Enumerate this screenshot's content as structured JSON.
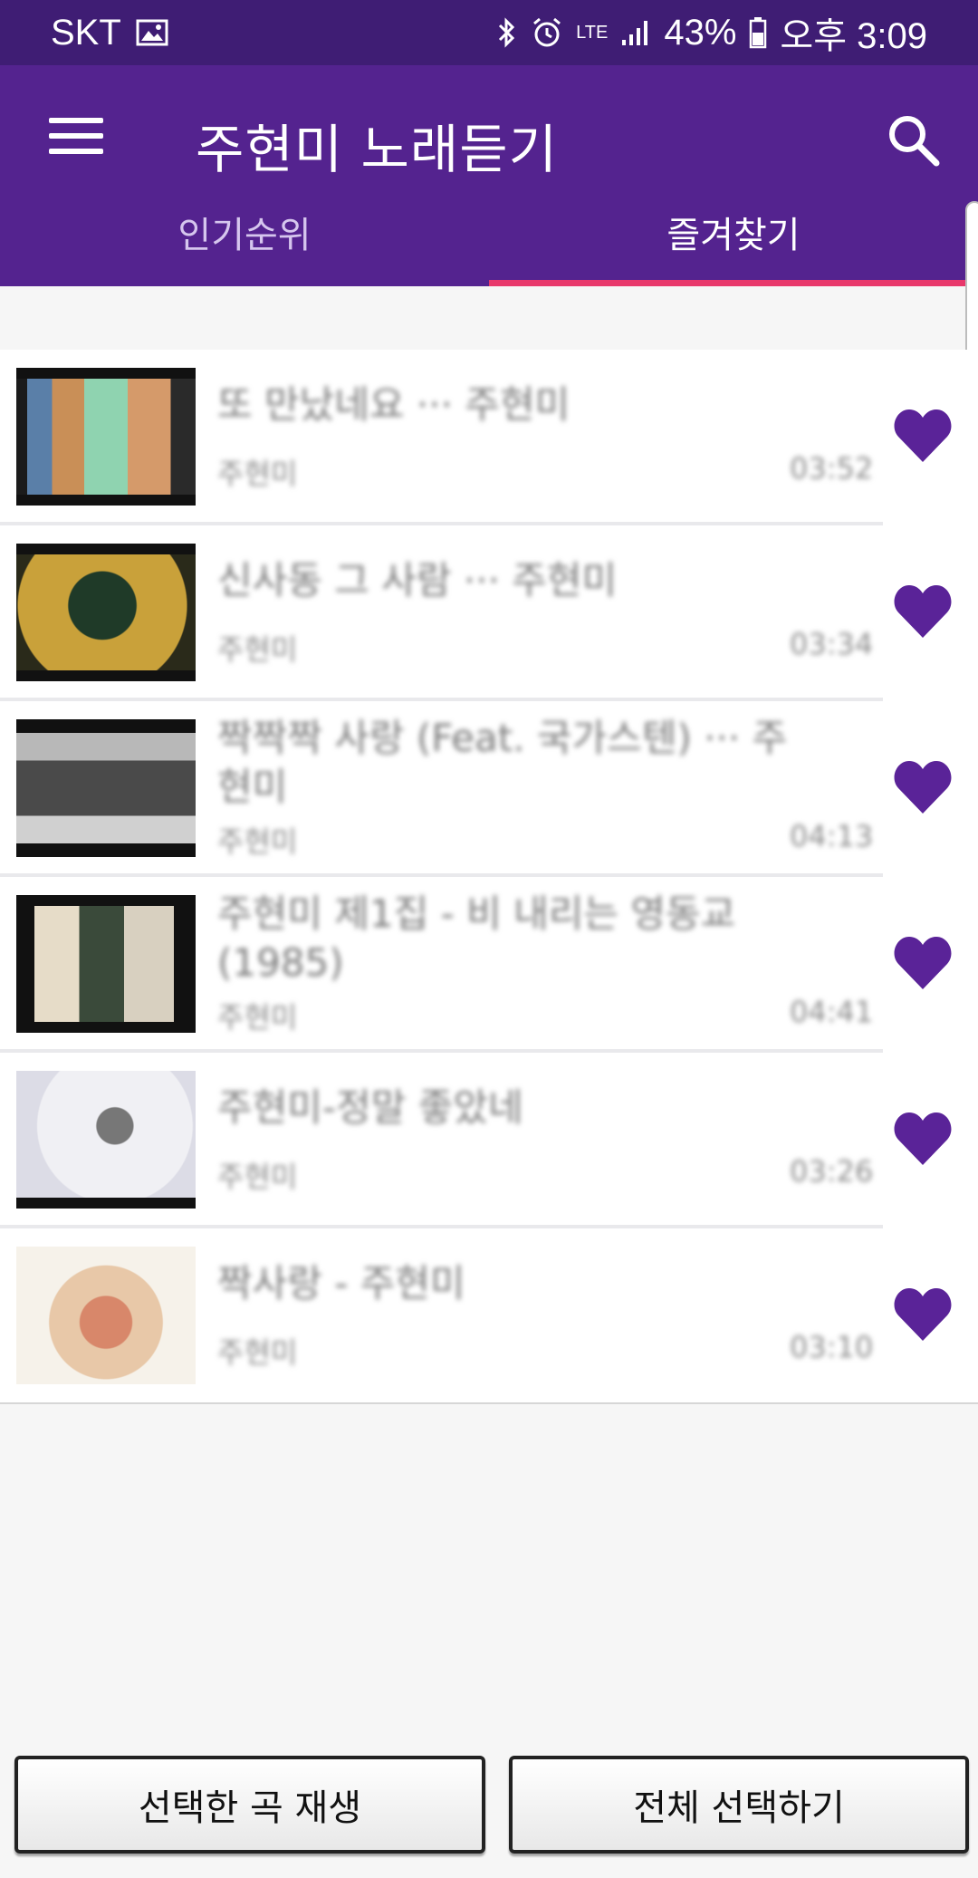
{
  "status_bar": {
    "carrier": "SKT",
    "battery": "43%",
    "time": "오후 3:09",
    "network": "LTE"
  },
  "app_bar": {
    "title": "주현미 노래듣기"
  },
  "tabs": [
    {
      "label": "인기순위",
      "active": false
    },
    {
      "label": "즐겨찾기",
      "active": true
    }
  ],
  "songs": [
    {
      "title": "또 만났네요 ··· 주현미",
      "artist": "주현미",
      "duration": "03:52"
    },
    {
      "title": "신사동 그 사람 ··· 주현미",
      "artist": "주현미",
      "duration": "03:34"
    },
    {
      "title": "짝짝짝 사랑 (Feat. 국가스텐) ··· 주현미",
      "artist": "주현미",
      "duration": "04:13"
    },
    {
      "title": "주현미 제1집 - 비 내리는 영동교 (1985)",
      "artist": "주현미",
      "duration": "04:41"
    },
    {
      "title": "주현미-정말 좋았네",
      "artist": "주현미",
      "duration": "03:26"
    },
    {
      "title": "짝사랑 - 주현미",
      "artist": "주현미",
      "duration": "03:10"
    }
  ],
  "buttons": {
    "play_selected": "선택한 곡 재생",
    "select_all": "전체 선택하기"
  },
  "colors": {
    "status_bar": "#3f1d74",
    "app_bar": "#54238f",
    "tab_indicator": "#e8386b",
    "heart": "#5a2398"
  }
}
